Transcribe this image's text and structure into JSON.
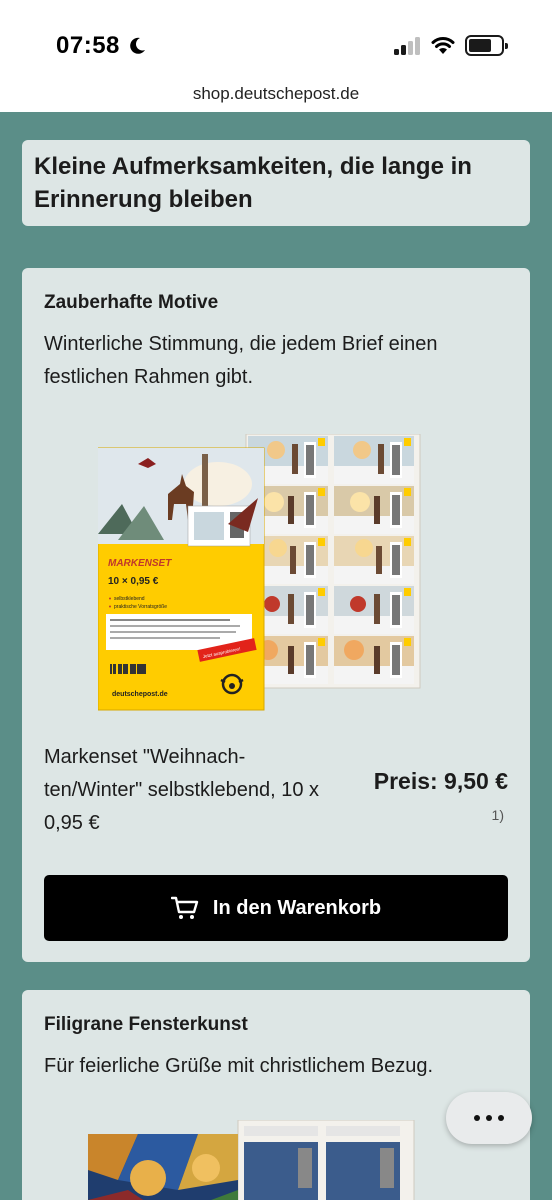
{
  "status_bar": {
    "time": "07:58",
    "icons": [
      "moon-icon",
      "cellular-signal-icon",
      "wifi-icon",
      "battery-icon"
    ]
  },
  "browser": {
    "url": "shop.deutschepost.de"
  },
  "header": {
    "title": "Kleine Aufmerksamkeiten, die lange in Erinnerung bleiben"
  },
  "products": [
    {
      "heading": "Zauberhafte Motive",
      "description": "Winterliche Stimmung, die jedem Brief einen festlichen Rahmen gibt.",
      "image": {
        "set_title": "MARKENSET",
        "set_value": "10 × 0,95 €",
        "bullets": [
          "selbstklebend",
          "praktische Vorratsgröße"
        ],
        "sticker": "Jetzt ausprobieren!",
        "brand": "deutschepost.de"
      },
      "name": "Markenset \"Weihnach-ten/Winter\" selbstklebend, 10 x 0,95 €",
      "price": "Preis: 9,50 €",
      "footnote": "1)",
      "cart_button": "In den Warenkorb"
    },
    {
      "heading": "Filigrane Fensterkunst",
      "description": "Für feierliche Grüße mit christlichem Bezug."
    }
  ],
  "colors": {
    "page_bg": "#5b8e88",
    "card_bg": "#dde6e5",
    "button_bg": "#000000",
    "brand_yellow": "#ffcc00"
  }
}
